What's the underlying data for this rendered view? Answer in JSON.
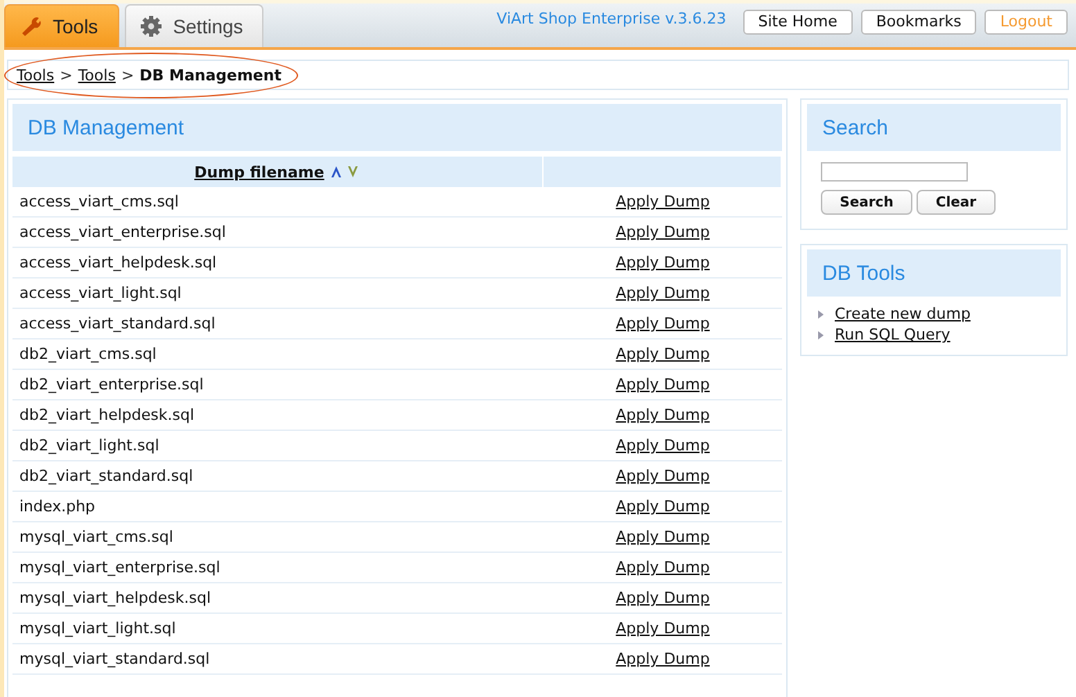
{
  "tabs": [
    {
      "label": "Tools",
      "kind": "wrench",
      "selected": true
    },
    {
      "label": "Settings",
      "kind": "gear",
      "selected": false
    }
  ],
  "version": "ViArt Shop Enterprise v.3.6.23",
  "top_buttons": [
    {
      "label": "Site Home",
      "kind": "normal"
    },
    {
      "label": "Bookmarks",
      "kind": "normal"
    },
    {
      "label": "Logout",
      "kind": "logout"
    }
  ],
  "breadcrumb": {
    "links": [
      "Tools",
      "Tools"
    ],
    "separator": ">",
    "current": "DB Management",
    "circled": true
  },
  "main": {
    "title": "DB Management",
    "columns": [
      {
        "label": "Dump filename",
        "kind": "sortable"
      },
      {
        "kind": "blank"
      }
    ],
    "rows": [
      {
        "file": "access_viart_cms.sql",
        "action": "Apply Dump"
      },
      {
        "file": "access_viart_enterprise.sql",
        "action": "Apply Dump"
      },
      {
        "file": "access_viart_helpdesk.sql",
        "action": "Apply Dump"
      },
      {
        "file": "access_viart_light.sql",
        "action": "Apply Dump"
      },
      {
        "file": "access_viart_standard.sql",
        "action": "Apply Dump"
      },
      {
        "file": "db2_viart_cms.sql",
        "action": "Apply Dump"
      },
      {
        "file": "db2_viart_enterprise.sql",
        "action": "Apply Dump"
      },
      {
        "file": "db2_viart_helpdesk.sql",
        "action": "Apply Dump"
      },
      {
        "file": "db2_viart_light.sql",
        "action": "Apply Dump"
      },
      {
        "file": "db2_viart_standard.sql",
        "action": "Apply Dump"
      },
      {
        "file": "index.php",
        "action": "Apply Dump"
      },
      {
        "file": "mysql_viart_cms.sql",
        "action": "Apply Dump"
      },
      {
        "file": "mysql_viart_enterprise.sql",
        "action": "Apply Dump"
      },
      {
        "file": "mysql_viart_helpdesk.sql",
        "action": "Apply Dump"
      },
      {
        "file": "mysql_viart_light.sql",
        "action": "Apply Dump"
      },
      {
        "file": "mysql_viart_standard.sql",
        "action": "Apply Dump"
      }
    ]
  },
  "search": {
    "title": "Search",
    "buttons": [
      "Search",
      "Clear"
    ]
  },
  "db_tools": {
    "title": "DB Tools",
    "links": [
      "Create new dump",
      "Run SQL Query"
    ]
  }
}
